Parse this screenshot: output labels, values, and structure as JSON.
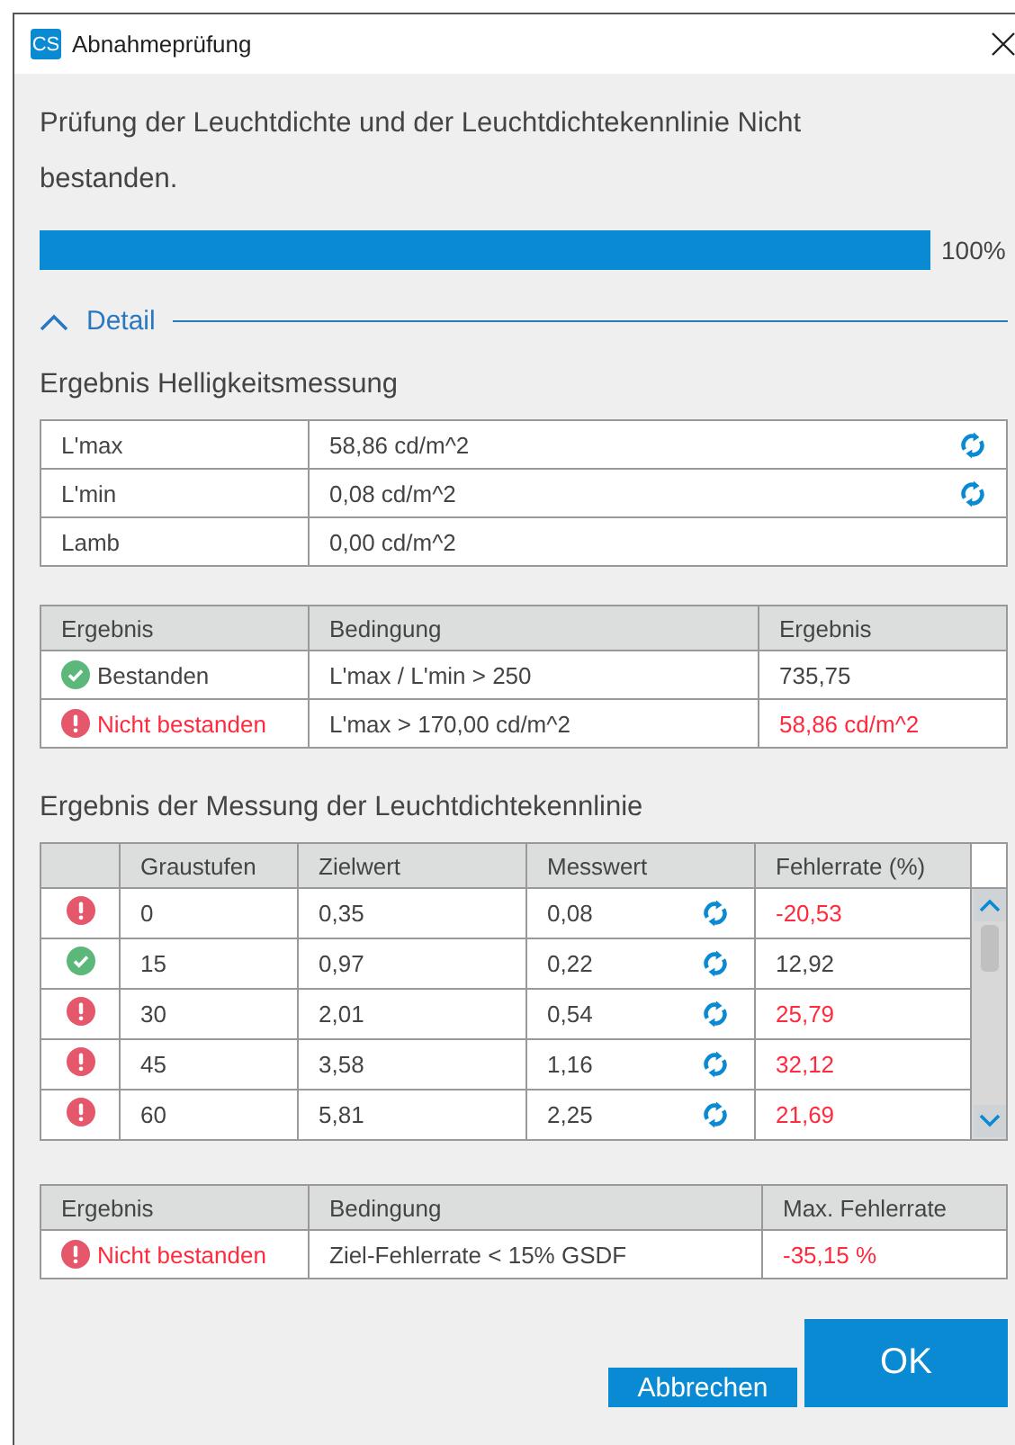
{
  "window": {
    "title": "Abnahmeprüfung",
    "app_icon": "CS"
  },
  "message": "Prüfung der Leuchtdichte und der Leuchtdichtekennlinie Nicht bestanden.",
  "progress": {
    "level": 1,
    "label": "100%"
  },
  "detail": {
    "label": "Detail",
    "expanded": true
  },
  "brightness": {
    "heading": "Ergebnis Helligkeitsmessung",
    "rows": [
      {
        "name": "L'max",
        "value": "58,86 cd/m^2",
        "refresh": true
      },
      {
        "name": "L'min",
        "value": "0,08 cd/m^2",
        "refresh": true
      },
      {
        "name": "Lamb",
        "value": "0,00 cd/m^2",
        "refresh": false
      }
    ]
  },
  "brightness_result": {
    "columns": [
      "Ergebnis",
      "Bedingung",
      "Ergebnis"
    ],
    "rows": [
      {
        "kind": "pass",
        "result": "Bestanden",
        "condition": "L'max / L'min > 250",
        "value": "735,75"
      },
      {
        "kind": "fail",
        "result": "Nicht bestanden",
        "condition": "L'max > 170,00 cd/m^2",
        "value": "58,86 cd/m^2"
      }
    ]
  },
  "curve": {
    "heading": "Ergebnis der Messung der Leuchtdichtekennlinie",
    "columns": [
      "Graustufen",
      "Zielwert",
      "Messwert",
      "Fehlerrate (%)"
    ],
    "rows": [
      {
        "kind": "fail",
        "gray": "0",
        "target": "0,35",
        "measured": "0,08",
        "error": "-20,53"
      },
      {
        "kind": "pass",
        "gray": "15",
        "target": "0,97",
        "measured": "0,22",
        "error": "12,92"
      },
      {
        "kind": "fail",
        "gray": "30",
        "target": "2,01",
        "measured": "0,54",
        "error": "25,79"
      },
      {
        "kind": "fail",
        "gray": "45",
        "target": "3,58",
        "measured": "1,16",
        "error": "32,12"
      },
      {
        "kind": "fail",
        "gray": "60",
        "target": "5,81",
        "measured": "2,25",
        "error": "21,69"
      }
    ]
  },
  "curve_result": {
    "columns": [
      "Ergebnis",
      "Bedingung",
      "Max. Fehlerrate"
    ],
    "rows": [
      {
        "kind": "fail",
        "result": "Nicht bestanden",
        "condition": "Ziel-Fehlerrate < 15% GSDF",
        "value": "-35,15 %"
      }
    ]
  },
  "buttons": [
    {
      "label": "Abbrechen",
      "kind": "secondary"
    },
    {
      "label": "OK",
      "kind": "primary"
    }
  ]
}
